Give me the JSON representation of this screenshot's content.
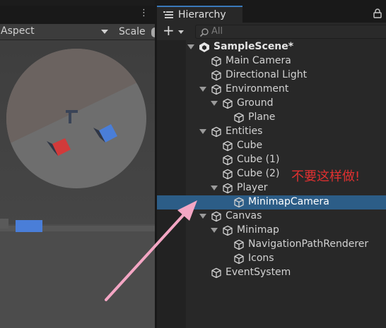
{
  "game_view": {
    "menu_dots": "⋮",
    "aspect_label": "Aspect",
    "scale_label": "Scale"
  },
  "hierarchy": {
    "tab_label": "Hierarchy",
    "add_label": "+",
    "search_placeholder": "All",
    "annotation": "不要这样做!",
    "rows": [
      {
        "label": "SampleScene*",
        "depth": 0,
        "foldout": true,
        "icon": "unity-scene-icon",
        "selected": false
      },
      {
        "label": "Main Camera",
        "depth": 1,
        "foldout": false,
        "icon": "gameobject-cube-icon",
        "selected": false
      },
      {
        "label": "Directional Light",
        "depth": 1,
        "foldout": false,
        "icon": "gameobject-cube-icon",
        "selected": false
      },
      {
        "label": "Environment",
        "depth": 1,
        "foldout": true,
        "icon": "gameobject-cube-icon",
        "selected": false
      },
      {
        "label": "Ground",
        "depth": 2,
        "foldout": true,
        "icon": "gameobject-cube-icon",
        "selected": false
      },
      {
        "label": "Plane",
        "depth": 3,
        "foldout": false,
        "icon": "gameobject-cube-icon",
        "selected": false
      },
      {
        "label": "Entities",
        "depth": 1,
        "foldout": true,
        "icon": "gameobject-cube-icon",
        "selected": false
      },
      {
        "label": "Cube",
        "depth": 2,
        "foldout": false,
        "icon": "gameobject-cube-icon",
        "selected": false
      },
      {
        "label": "Cube (1)",
        "depth": 2,
        "foldout": false,
        "icon": "gameobject-cube-icon",
        "selected": false
      },
      {
        "label": "Cube (2)",
        "depth": 2,
        "foldout": false,
        "icon": "gameobject-cube-icon",
        "selected": false
      },
      {
        "label": "Player",
        "depth": 2,
        "foldout": true,
        "icon": "gameobject-cube-icon",
        "selected": false
      },
      {
        "label": "MinimapCamera",
        "depth": 3,
        "foldout": false,
        "icon": "gameobject-cube-icon",
        "selected": true
      },
      {
        "label": "Canvas",
        "depth": 1,
        "foldout": true,
        "icon": "gameobject-cube-icon",
        "selected": false
      },
      {
        "label": "Minimap",
        "depth": 2,
        "foldout": true,
        "icon": "gameobject-cube-icon",
        "selected": false
      },
      {
        "label": "NavigationPathRenderer",
        "depth": 3,
        "foldout": false,
        "icon": "gameobject-cube-icon",
        "selected": false
      },
      {
        "label": "Icons",
        "depth": 3,
        "foldout": false,
        "icon": "gameobject-cube-icon",
        "selected": false
      },
      {
        "label": "EventSystem",
        "depth": 1,
        "foldout": false,
        "icon": "gameobject-cube-icon",
        "selected": false
      }
    ]
  },
  "colors": {
    "selection": "#2c5d87",
    "annotation": "#e03030",
    "arrow": "#f4a6c4",
    "cube_red": "#d23a3a",
    "cube_blue": "#4a7ed8"
  }
}
